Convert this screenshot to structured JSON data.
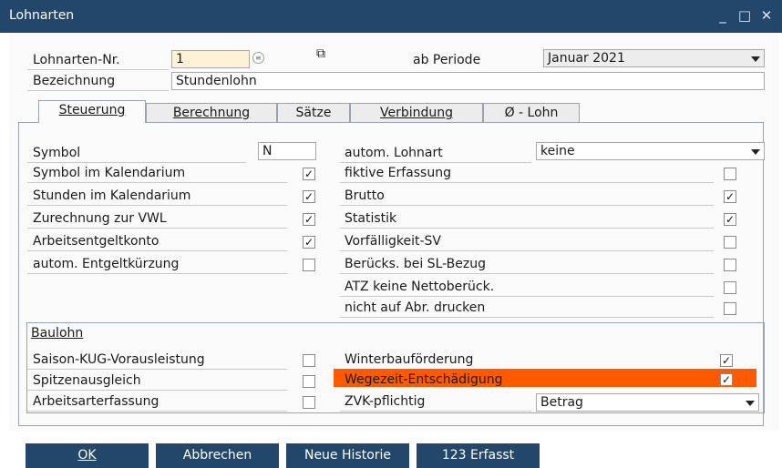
{
  "window": {
    "title": "Lohnarten",
    "min": "_",
    "max": "□",
    "close": "✕"
  },
  "header": {
    "nr_label": "Lohnarten-Nr.",
    "nr_value": "1",
    "periode_label": "ab Periode",
    "periode_value": "Januar 2021",
    "bez_label": "Bezeichnung",
    "bez_value": "Stundenlohn"
  },
  "tabs": [
    {
      "label": "Steuerung"
    },
    {
      "label": "Berechnung"
    },
    {
      "label": "Sätze"
    },
    {
      "label": "Verbindung"
    },
    {
      "label": "Ø - Lohn"
    }
  ],
  "left": {
    "symbol_label": "Symbol",
    "symbol_value": "N",
    "items": [
      {
        "label": "Symbol im Kalendarium",
        "checked": true
      },
      {
        "label": "Stunden im Kalendarium",
        "checked": true
      },
      {
        "label": "Zurechnung zur VWL",
        "checked": true
      },
      {
        "label": "Arbeitsentgeltkonto",
        "checked": true
      },
      {
        "label": "autom. Entgeltkürzung",
        "checked": false
      }
    ]
  },
  "right": {
    "autom_label": "autom. Lohnart",
    "autom_value": "keine",
    "items": [
      {
        "label": "fiktive Erfassung",
        "checked": false
      },
      {
        "label": "Brutto",
        "checked": true
      },
      {
        "label": "Statistik",
        "checked": true
      },
      {
        "label": "Vorfälligkeit-SV",
        "checked": false
      },
      {
        "label": "Berücks. bei SL-Bezug",
        "checked": false
      },
      {
        "label": "ATZ keine Nettoberück.",
        "checked": false
      },
      {
        "label": "nicht auf Abr. drucken",
        "checked": false
      }
    ]
  },
  "baulohn": {
    "title": "Baulohn",
    "left": [
      {
        "label": "Saison-KUG-Vorausleistung",
        "checked": false
      },
      {
        "label": "Spitzenausgleich",
        "checked": false
      },
      {
        "label": "Arbeitsarterfassung",
        "checked": false
      }
    ],
    "right": [
      {
        "label": "Winterbauförderung",
        "checked": true
      },
      {
        "label": "Wegezeit-Entschädigung",
        "checked": true
      }
    ],
    "zvk_label": "ZVK-pflichtig",
    "zvk_value": "Betrag",
    "highlight_color": "#ff5a00"
  },
  "buttons": {
    "ok": "OK",
    "cancel": "Abbrechen",
    "history": "Neue Historie",
    "count": "123 Erfasst"
  },
  "colors": {
    "titlebar": "#23466b",
    "button": "#23466b",
    "highlight": "#ff5a00"
  }
}
